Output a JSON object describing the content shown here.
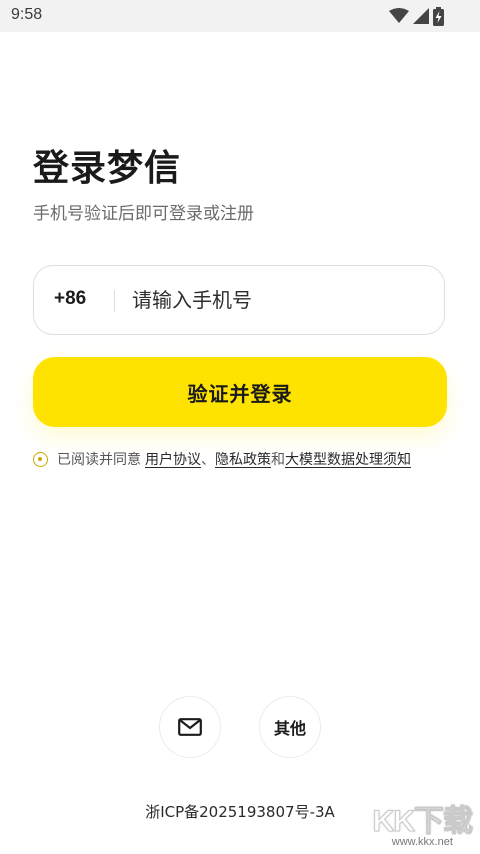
{
  "status_bar": {
    "time": "9:58",
    "icons": [
      "wifi-icon",
      "signal-icon",
      "battery-charging-icon"
    ]
  },
  "login": {
    "title": "登录梦信",
    "subtitle": "手机号验证后即可登录或注册",
    "country_code": "+86",
    "phone_placeholder": "请输入手机号",
    "phone_value": "",
    "submit_label": "验证并登录"
  },
  "agreement": {
    "checked": false,
    "prefix": "已阅读并同意",
    "link_user_agreement": "用户协议",
    "separator": "、",
    "link_privacy": "隐私政策",
    "conjunction": "和",
    "link_model_notice": "大模型数据处理须知"
  },
  "alt_login": {
    "email_icon": "mail-icon",
    "other_label": "其他"
  },
  "footer": {
    "icp": "浙ICP备2025193807号-3A"
  },
  "watermark": {
    "main": "KK下载",
    "sub": "www.kkx.net"
  },
  "colors": {
    "accent": "#ffe300",
    "radio": "#c9a900",
    "status_bar_bg": "#f2f2f2"
  }
}
